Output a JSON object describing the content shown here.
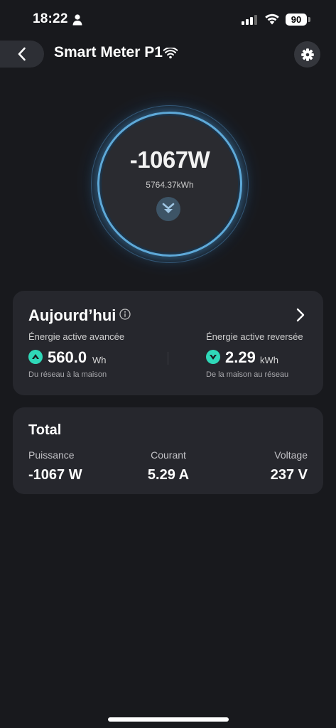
{
  "status_bar": {
    "time": "18:22",
    "battery": "90"
  },
  "header": {
    "title": "Smart Meter P1"
  },
  "gauge": {
    "power": "-1067W",
    "energy": "5764.37kWh"
  },
  "today": {
    "title": "Aujourd’hui",
    "forward": {
      "label": "Énergie active avancée",
      "value": "560.0",
      "unit": "Wh",
      "caption": "Du réseau à la maison"
    },
    "reverse": {
      "label": "Énergie active reversée",
      "value": "2.29",
      "unit": "kWh",
      "caption": "De la maison au réseau"
    }
  },
  "total": {
    "title": "Total",
    "items": [
      {
        "label": "Puissance",
        "value": "-1067 W"
      },
      {
        "label": "Courant",
        "value": "5.29 A"
      },
      {
        "label": "Voltage",
        "value": "237 V"
      }
    ]
  },
  "colors": {
    "background": "#18191d",
    "card": "#26272d",
    "accent_teal": "#2fd8b8",
    "ring_blue": "#5ea9d8"
  },
  "icons": [
    "person-icon",
    "signal-icon",
    "wifi-icon",
    "battery-icon",
    "back-arrow-icon",
    "gear-icon",
    "info-icon",
    "chevron-right-icon",
    "arrow-up-circle-icon",
    "arrow-down-circle-icon",
    "double-chevron-down-icon"
  ]
}
